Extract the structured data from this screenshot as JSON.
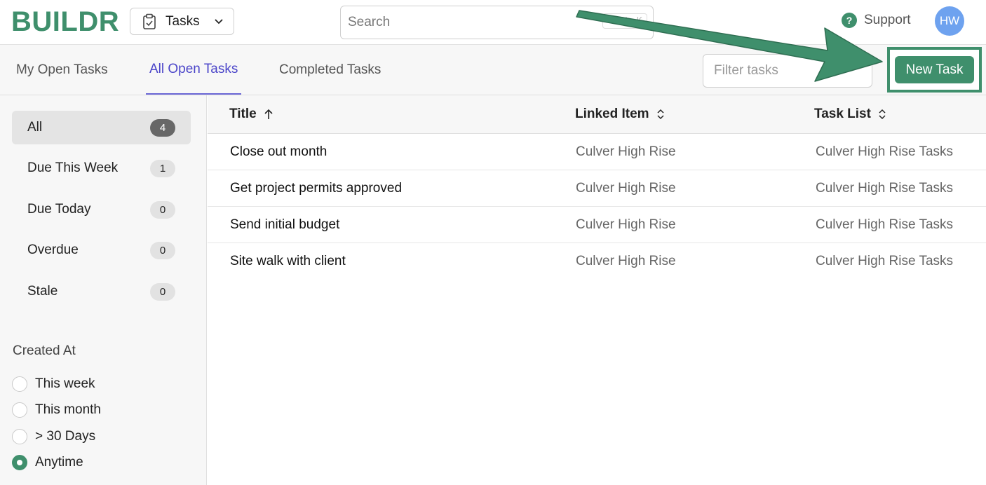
{
  "header": {
    "logo": "BUILDR",
    "module": "Tasks",
    "search_placeholder": "Search",
    "search_shortcut": "CTRL K",
    "support_label": "Support",
    "avatar_initials": "HW"
  },
  "tabs": [
    {
      "label": "My Open Tasks",
      "active": false
    },
    {
      "label": "All Open Tasks",
      "active": true
    },
    {
      "label": "Completed Tasks",
      "active": false
    }
  ],
  "toolbar": {
    "filter_placeholder": "Filter tasks",
    "new_task_label": "New Task"
  },
  "sidebar": {
    "items": [
      {
        "label": "All",
        "count": "4",
        "active": true
      },
      {
        "label": "Due This Week",
        "count": "1",
        "active": false
      },
      {
        "label": "Due Today",
        "count": "0",
        "active": false
      },
      {
        "label": "Overdue",
        "count": "0",
        "active": false
      },
      {
        "label": "Stale",
        "count": "0",
        "active": false
      }
    ],
    "created_at": {
      "title": "Created At",
      "options": [
        {
          "label": "This week",
          "checked": false
        },
        {
          "label": "This month",
          "checked": false
        },
        {
          "label": "> 30 Days",
          "checked": false
        },
        {
          "label": "Anytime",
          "checked": true
        }
      ]
    }
  },
  "table": {
    "columns": [
      "Title",
      "Linked Item",
      "Task List"
    ],
    "rows": [
      {
        "title": "Close out month",
        "linked_item": "Culver High Rise",
        "task_list": "Culver High Rise Tasks"
      },
      {
        "title": "Get project permits approved",
        "linked_item": "Culver High Rise",
        "task_list": "Culver High Rise Tasks"
      },
      {
        "title": "Send initial budget",
        "linked_item": "Culver High Rise",
        "task_list": "Culver High Rise Tasks"
      },
      {
        "title": "Site walk with client",
        "linked_item": "Culver High Rise",
        "task_list": "Culver High Rise Tasks"
      }
    ]
  },
  "colors": {
    "brand_green": "#3f8f6c",
    "active_tab": "#4b45c9",
    "avatar": "#6ea2ef"
  }
}
